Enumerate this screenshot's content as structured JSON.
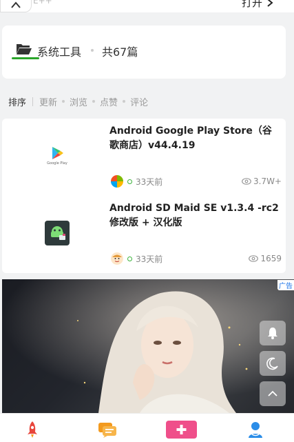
{
  "top": {
    "faded_text": "E++",
    "open_label": "打开"
  },
  "category": {
    "name": "系统工具",
    "count": "共67篇"
  },
  "sort": {
    "label": "排序",
    "options": [
      "更新",
      "浏览",
      "点赞",
      "评论"
    ]
  },
  "posts": [
    {
      "title": "Android Google Play Store（谷歌商店）v44.4.19",
      "thumb_caption": "Google Play",
      "time": "33天前",
      "views": "3.7W+"
    },
    {
      "title": "Android SD Maid SE v1.3.4 -rc2 修改版 + 汉化版",
      "thumb_caption": "",
      "time": "33天前",
      "views": "1659"
    }
  ],
  "ad": {
    "label": "广告"
  },
  "colors": {
    "accent_green": "#2aa52a",
    "nav_red": "#e8463c",
    "nav_orange": "#f39a1e",
    "nav_pink": "#ef4f8a",
    "nav_blue": "#2b8de8"
  },
  "icons": {
    "float": [
      "bell-icon",
      "moon-icon",
      "chevron-up-icon"
    ],
    "nav": [
      "rocket-icon",
      "chat-icon",
      "plus-icon",
      "user-icon"
    ]
  }
}
